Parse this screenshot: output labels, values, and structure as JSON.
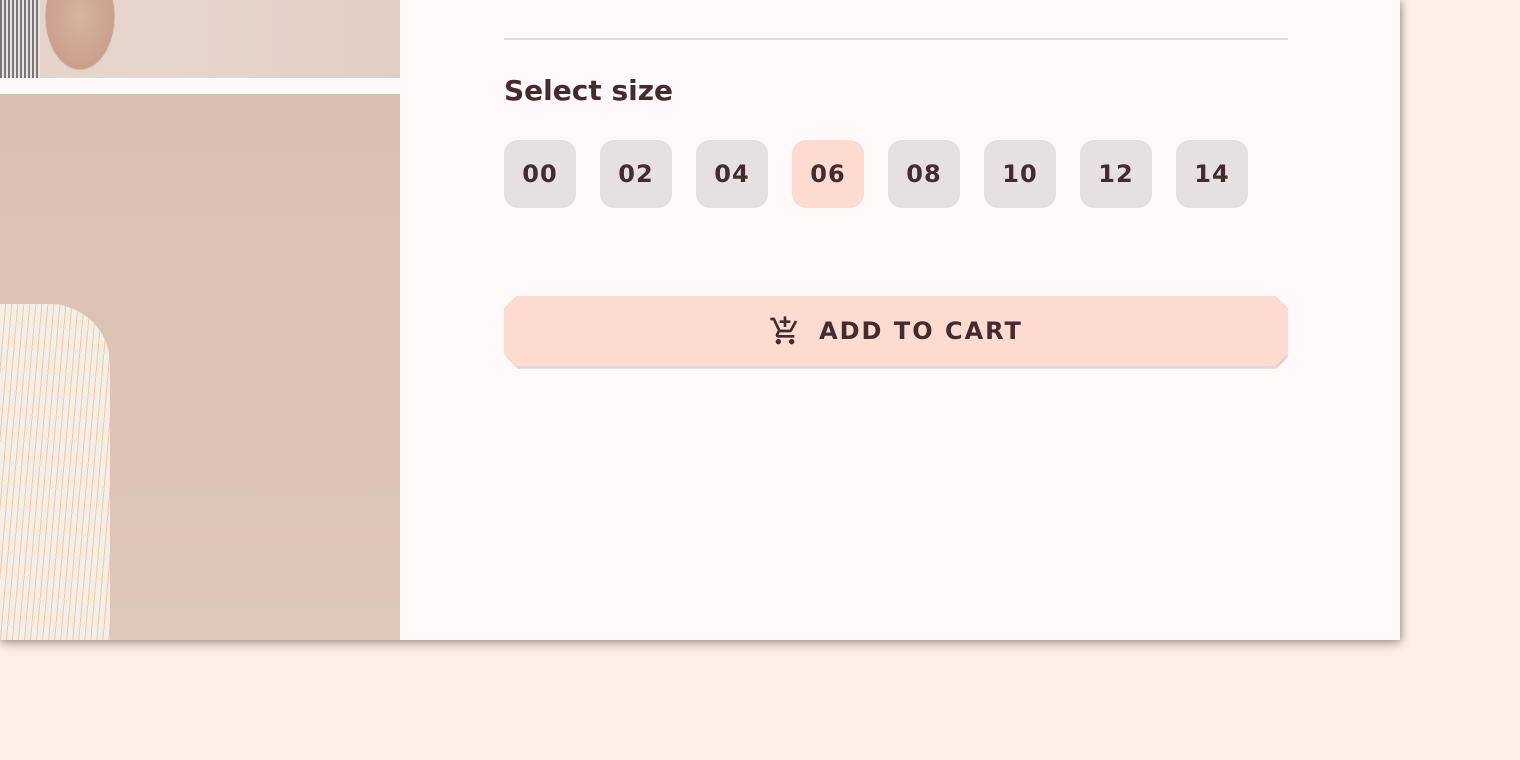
{
  "product": {
    "size_section_title": "Select size",
    "sizes": [
      {
        "label": "00"
      },
      {
        "label": "02"
      },
      {
        "label": "04"
      },
      {
        "label": "06"
      },
      {
        "label": "08"
      },
      {
        "label": "10"
      },
      {
        "label": "12"
      },
      {
        "label": "14"
      }
    ],
    "selected_size": "06",
    "add_to_cart_label": "ADD TO CART",
    "add_to_cart_icon": "add-shopping-cart-icon"
  },
  "colors": {
    "page_background": "#fef0e7",
    "card_background": "#fffaf9",
    "text": "#442b2d",
    "chip": "#e7e0e0",
    "accent": "#fddbd0"
  }
}
